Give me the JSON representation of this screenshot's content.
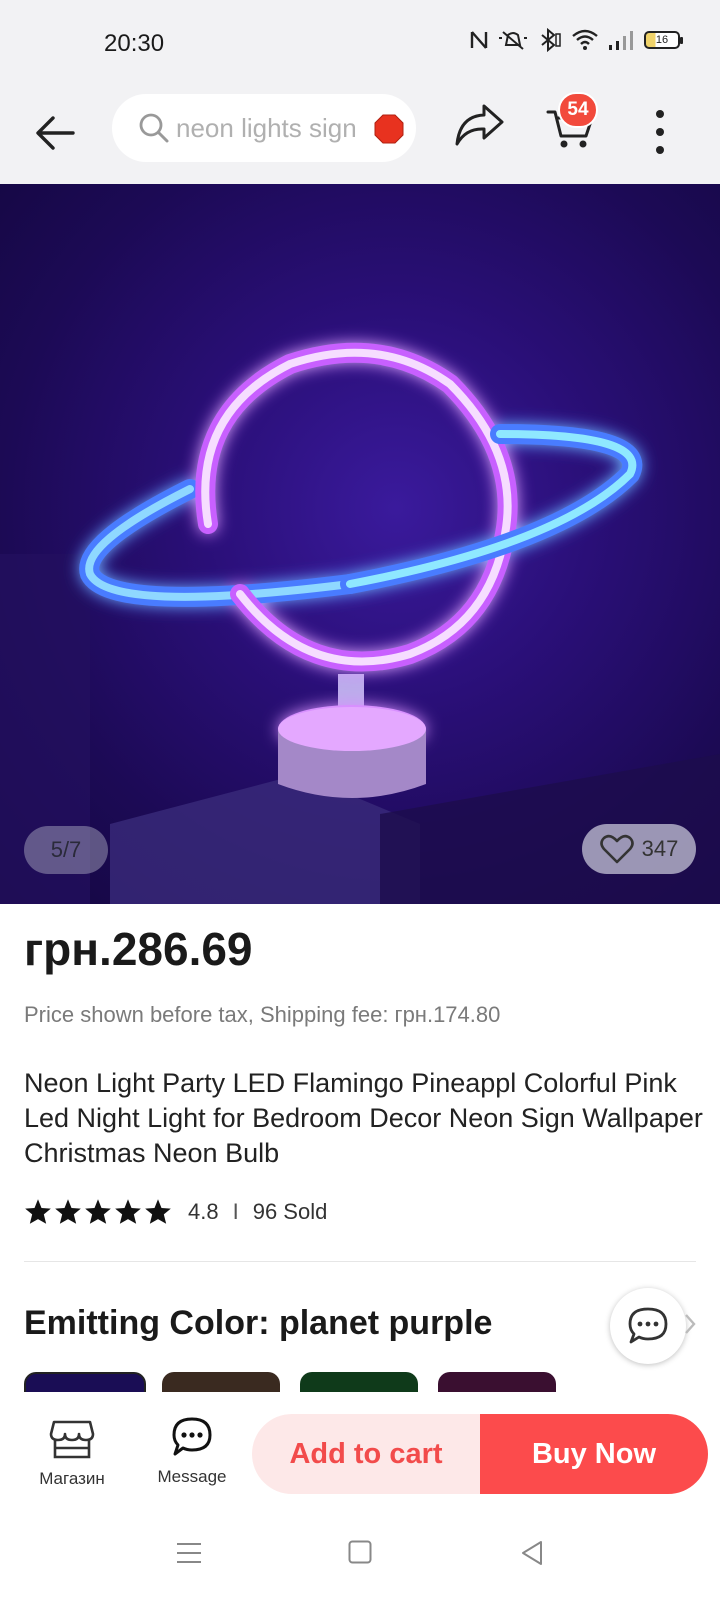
{
  "status_bar": {
    "time": "20:30",
    "battery_level": "16",
    "icons": [
      "nfc-icon",
      "mute-icon",
      "bluetooth-icon",
      "wifi-icon",
      "signal-icon",
      "battery-icon"
    ]
  },
  "top_nav": {
    "search_text": "neon lights sign",
    "cart_count": "54",
    "icons": [
      "back-arrow-icon",
      "search-icon",
      "stop-icon",
      "share-icon",
      "cart-icon",
      "more-vertical-icon"
    ]
  },
  "gallery": {
    "pager": "5/7",
    "likes": "347"
  },
  "product": {
    "price": "грн.286.69",
    "tax_note": "Price shown before tax, Shipping fee: грн.174.80",
    "title": "Neon Light Party LED Flamingo Pineappl Colorful Pink Led Night Light for Bedroom Decor Neon Sign Wallpaper Christmas Neon Bulb",
    "rating": "4.8",
    "stars": 5,
    "sold": "96 Sold",
    "separator": "I",
    "color_label": "Emitting Color: planet purple"
  },
  "bottom_bar": {
    "store_label": "Магазин",
    "message_label": "Message",
    "add_to_cart": "Add to cart",
    "buy_now": "Buy Now"
  },
  "colors": {
    "accent": "#fc4b4c",
    "add_cart_bg": "#fde8e8",
    "badge": "#f24a3c"
  }
}
